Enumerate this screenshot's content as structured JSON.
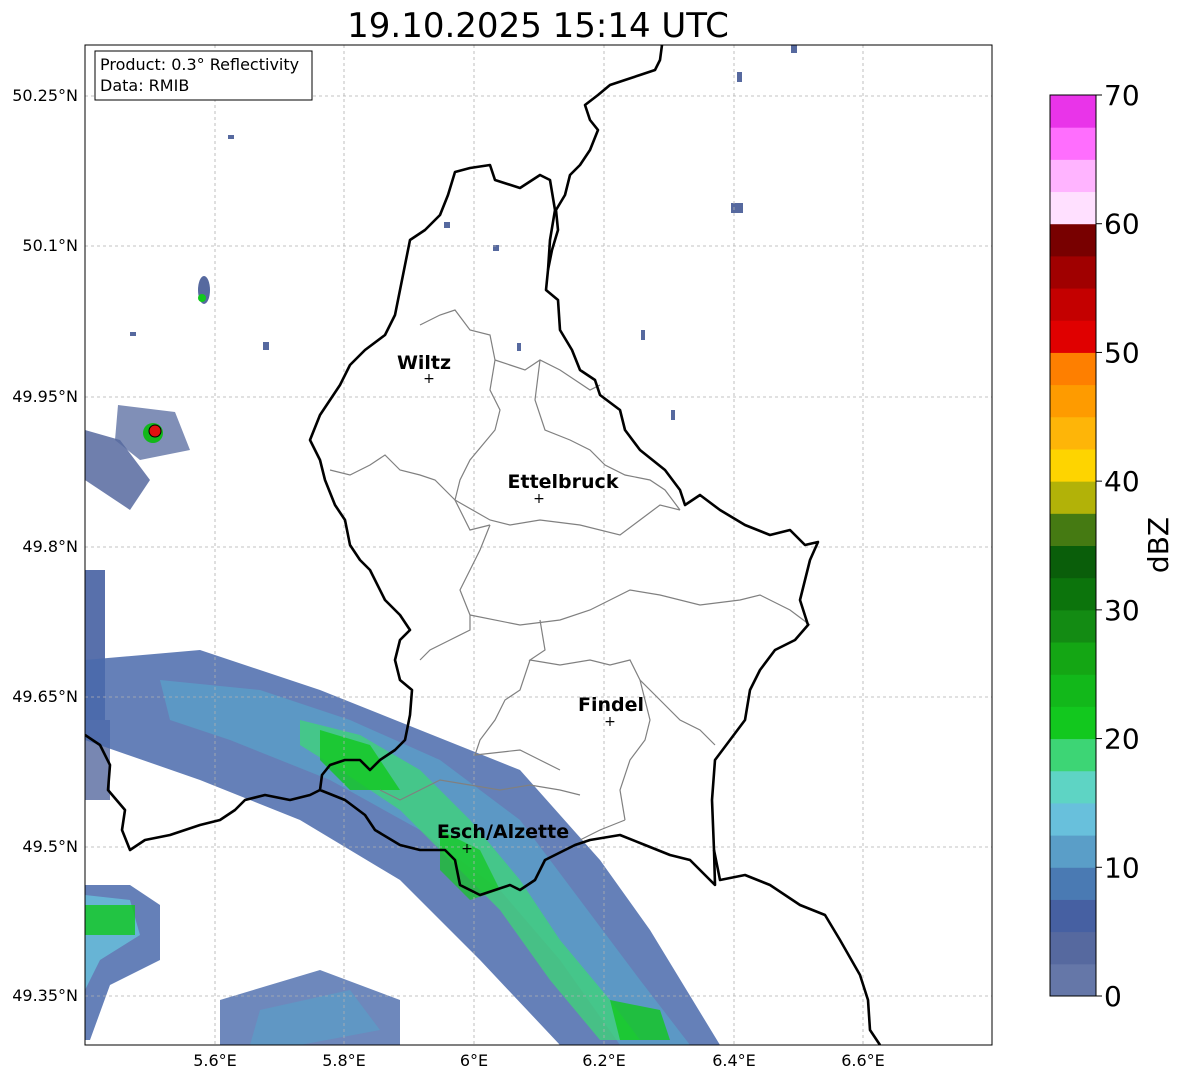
{
  "title": "19.10.2025 15:14 UTC",
  "info_box": {
    "product": "Product: 0.3° Reflectivity",
    "data": "Data: RMIB"
  },
  "axes": {
    "lon_ticks": [
      "5.6°E",
      "5.8°E",
      "6°E",
      "6.2°E",
      "6.4°E",
      "6.6°E"
    ],
    "lat_ticks": [
      "50.25°N",
      "50.1°N",
      "49.95°N",
      "49.8°N",
      "49.65°N",
      "49.5°N",
      "49.35°N"
    ]
  },
  "cities": [
    {
      "name": "Wiltz"
    },
    {
      "name": "Ettelbruck"
    },
    {
      "name": "Findel"
    },
    {
      "name": "Esch/Alzette"
    }
  ],
  "colorbar": {
    "label": "dBZ",
    "ticks": [
      "0",
      "10",
      "20",
      "30",
      "40",
      "50",
      "60",
      "70"
    ],
    "colors": [
      "#6577a8",
      "#56699f",
      "#4660a2",
      "#4a7ab3",
      "#5a9ec8",
      "#68c0dc",
      "#5ed4c4",
      "#3dd575",
      "#12c81e",
      "#12b81a",
      "#14a614",
      "#138b13",
      "#0c740c",
      "#0a5e0a",
      "#457a12",
      "#b2b208",
      "#fed400",
      "#feb508",
      "#fe9b00",
      "#fe7f00",
      "#e00000",
      "#c40000",
      "#a00000",
      "#780000",
      "#ffe0ff",
      "#ffb4ff",
      "#ff6efe",
      "#e934e9"
    ]
  },
  "colors": {
    "border": "#000000",
    "canton": "#808080",
    "grid": "#b0b0b0",
    "radar_site": "#e01010"
  }
}
